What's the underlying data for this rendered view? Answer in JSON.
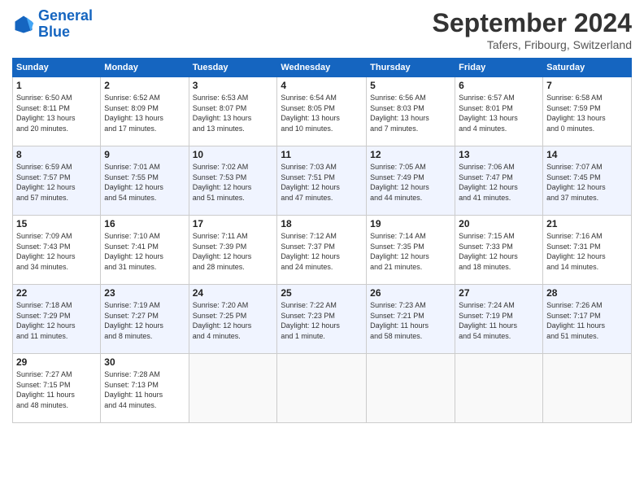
{
  "header": {
    "logo_line1": "General",
    "logo_line2": "Blue",
    "month": "September 2024",
    "location": "Tafers, Fribourg, Switzerland"
  },
  "weekdays": [
    "Sunday",
    "Monday",
    "Tuesday",
    "Wednesday",
    "Thursday",
    "Friday",
    "Saturday"
  ],
  "weeks": [
    [
      {
        "day": "1",
        "info": "Sunrise: 6:50 AM\nSunset: 8:11 PM\nDaylight: 13 hours\nand 20 minutes."
      },
      {
        "day": "2",
        "info": "Sunrise: 6:52 AM\nSunset: 8:09 PM\nDaylight: 13 hours\nand 17 minutes."
      },
      {
        "day": "3",
        "info": "Sunrise: 6:53 AM\nSunset: 8:07 PM\nDaylight: 13 hours\nand 13 minutes."
      },
      {
        "day": "4",
        "info": "Sunrise: 6:54 AM\nSunset: 8:05 PM\nDaylight: 13 hours\nand 10 minutes."
      },
      {
        "day": "5",
        "info": "Sunrise: 6:56 AM\nSunset: 8:03 PM\nDaylight: 13 hours\nand 7 minutes."
      },
      {
        "day": "6",
        "info": "Sunrise: 6:57 AM\nSunset: 8:01 PM\nDaylight: 13 hours\nand 4 minutes."
      },
      {
        "day": "7",
        "info": "Sunrise: 6:58 AM\nSunset: 7:59 PM\nDaylight: 13 hours\nand 0 minutes."
      }
    ],
    [
      {
        "day": "8",
        "info": "Sunrise: 6:59 AM\nSunset: 7:57 PM\nDaylight: 12 hours\nand 57 minutes."
      },
      {
        "day": "9",
        "info": "Sunrise: 7:01 AM\nSunset: 7:55 PM\nDaylight: 12 hours\nand 54 minutes."
      },
      {
        "day": "10",
        "info": "Sunrise: 7:02 AM\nSunset: 7:53 PM\nDaylight: 12 hours\nand 51 minutes."
      },
      {
        "day": "11",
        "info": "Sunrise: 7:03 AM\nSunset: 7:51 PM\nDaylight: 12 hours\nand 47 minutes."
      },
      {
        "day": "12",
        "info": "Sunrise: 7:05 AM\nSunset: 7:49 PM\nDaylight: 12 hours\nand 44 minutes."
      },
      {
        "day": "13",
        "info": "Sunrise: 7:06 AM\nSunset: 7:47 PM\nDaylight: 12 hours\nand 41 minutes."
      },
      {
        "day": "14",
        "info": "Sunrise: 7:07 AM\nSunset: 7:45 PM\nDaylight: 12 hours\nand 37 minutes."
      }
    ],
    [
      {
        "day": "15",
        "info": "Sunrise: 7:09 AM\nSunset: 7:43 PM\nDaylight: 12 hours\nand 34 minutes."
      },
      {
        "day": "16",
        "info": "Sunrise: 7:10 AM\nSunset: 7:41 PM\nDaylight: 12 hours\nand 31 minutes."
      },
      {
        "day": "17",
        "info": "Sunrise: 7:11 AM\nSunset: 7:39 PM\nDaylight: 12 hours\nand 28 minutes."
      },
      {
        "day": "18",
        "info": "Sunrise: 7:12 AM\nSunset: 7:37 PM\nDaylight: 12 hours\nand 24 minutes."
      },
      {
        "day": "19",
        "info": "Sunrise: 7:14 AM\nSunset: 7:35 PM\nDaylight: 12 hours\nand 21 minutes."
      },
      {
        "day": "20",
        "info": "Sunrise: 7:15 AM\nSunset: 7:33 PM\nDaylight: 12 hours\nand 18 minutes."
      },
      {
        "day": "21",
        "info": "Sunrise: 7:16 AM\nSunset: 7:31 PM\nDaylight: 12 hours\nand 14 minutes."
      }
    ],
    [
      {
        "day": "22",
        "info": "Sunrise: 7:18 AM\nSunset: 7:29 PM\nDaylight: 12 hours\nand 11 minutes."
      },
      {
        "day": "23",
        "info": "Sunrise: 7:19 AM\nSunset: 7:27 PM\nDaylight: 12 hours\nand 8 minutes."
      },
      {
        "day": "24",
        "info": "Sunrise: 7:20 AM\nSunset: 7:25 PM\nDaylight: 12 hours\nand 4 minutes."
      },
      {
        "day": "25",
        "info": "Sunrise: 7:22 AM\nSunset: 7:23 PM\nDaylight: 12 hours\nand 1 minute."
      },
      {
        "day": "26",
        "info": "Sunrise: 7:23 AM\nSunset: 7:21 PM\nDaylight: 11 hours\nand 58 minutes."
      },
      {
        "day": "27",
        "info": "Sunrise: 7:24 AM\nSunset: 7:19 PM\nDaylight: 11 hours\nand 54 minutes."
      },
      {
        "day": "28",
        "info": "Sunrise: 7:26 AM\nSunset: 7:17 PM\nDaylight: 11 hours\nand 51 minutes."
      }
    ],
    [
      {
        "day": "29",
        "info": "Sunrise: 7:27 AM\nSunset: 7:15 PM\nDaylight: 11 hours\nand 48 minutes."
      },
      {
        "day": "30",
        "info": "Sunrise: 7:28 AM\nSunset: 7:13 PM\nDaylight: 11 hours\nand 44 minutes."
      },
      null,
      null,
      null,
      null,
      null
    ]
  ]
}
